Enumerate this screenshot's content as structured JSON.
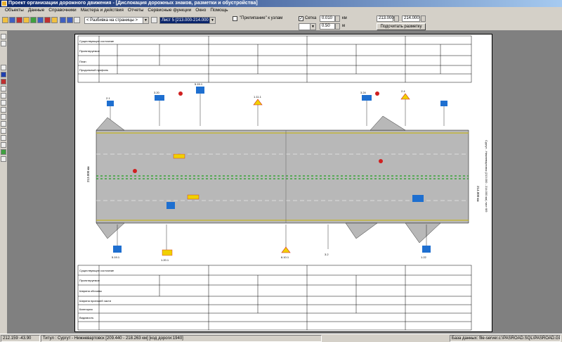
{
  "window": {
    "title": "Проект организации дорожного движения - [Дислокация дорожных знаков, разметки и обустройства]"
  },
  "menu": {
    "items": [
      "Объекты",
      "Данные",
      "Справочники",
      "Мастера и действия",
      "Отчеты",
      "Сервисные функции",
      "Окно",
      "Помощь"
    ]
  },
  "toolbar": {
    "page_split_combo": "< Разбивка на страницы >",
    "sheet_combo": "Лист 5 [213.000-214.000 км]",
    "snap_label": "\"Прилипание\" к узлам",
    "snap_checked": "",
    "grid_label": "Сетка",
    "grid_checked": "✓",
    "grid_step_x": "0.010",
    "grid_step_y": "0.50",
    "unit_km": "км",
    "unit_m": "м",
    "range_from": "213.000",
    "range_to": "214.000",
    "markup_button": "Подсчитать разметку"
  },
  "drawing": {
    "side_caption": "Сургут - Нижневартовск (213.000 - 214.000 км) лист 6/9",
    "left_caption": "213.000 км",
    "right_caption": "214.000 км",
    "top_rows": [
      "Существующее состояние",
      "Проектируемое",
      "План",
      "Продольный профиль"
    ],
    "bottom_rows": [
      "Существующее состояние",
      "Проектируемое",
      "Ширина обочины",
      "Ширина проезжей части",
      "Категория",
      "Видимость"
    ],
    "sign_labels": [
      "2.1",
      "3.20",
      "5.15.1",
      "1.11.1",
      "3.24",
      "2.4",
      "5.19.1",
      "1.20.1",
      "6.10.1",
      "3.2",
      "1.22"
    ],
    "colors": {
      "road": "#b8b8b8",
      "edge_line": "#c8b400",
      "center_dash": "#20a020",
      "sign_blue": "#1e6fd0",
      "sign_yellow": "#f0d000",
      "sign_red": "#d02020"
    }
  },
  "status": {
    "coords": "212.159 -43.90",
    "title_info": "Титул : Сургут - Нижневартовск [209.440 - 218.263 км] [код дороги:1940]",
    "db_info": "База данных: file-server.c:\\PASROAD.SQL\\PASROAD.GDB"
  }
}
